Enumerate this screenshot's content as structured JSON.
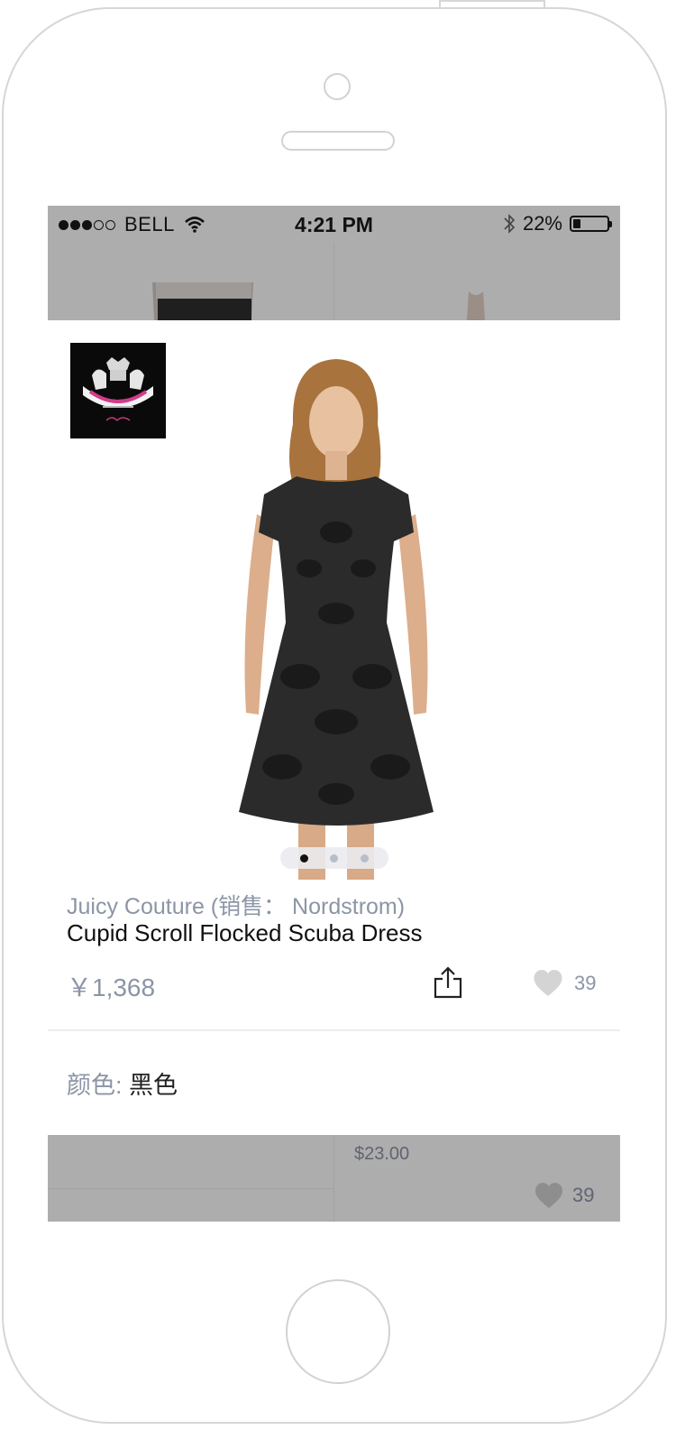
{
  "status_bar": {
    "carrier": "BELL",
    "signal_bars_filled": 3,
    "signal_bars_total": 5,
    "time": "4:21 PM",
    "battery_percent": "22%",
    "battery_level": 0.22
  },
  "product": {
    "brand_line": "Juicy Couture (销售： Nordstrom)",
    "title": "Cupid Scroll Flocked Scuba Dress",
    "price": "￥1,368",
    "likes": "39",
    "color_label": "颜色: ",
    "color_value": "黑色",
    "image_pages": 3,
    "active_page": 1
  },
  "background_item": {
    "price": "$23.00",
    "likes": "39"
  },
  "icons": {
    "share": "share-icon",
    "like": "heart-icon",
    "wifi": "wifi-icon",
    "bluetooth": "bluetooth-icon",
    "battery": "battery-icon"
  },
  "colors": {
    "overlay_gray": "#adadad",
    "muted_text": "#8b95a5",
    "heart_gray": "#d4d4d4"
  }
}
